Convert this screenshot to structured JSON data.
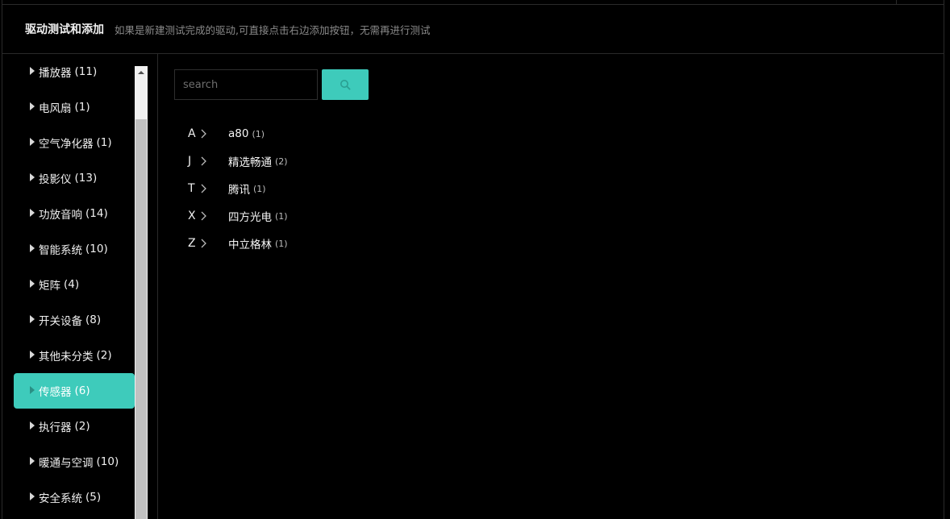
{
  "header": {
    "title": "驱动测试和添加",
    "subtitle": "如果是新建测试完成的驱动,可直接点击右边添加按钮，无需再进行测试"
  },
  "sidebar": {
    "items": [
      {
        "label": "播放器",
        "count": "(11)"
      },
      {
        "label": "电风扇",
        "count": "(1)"
      },
      {
        "label": "空气净化器",
        "count": "(1)"
      },
      {
        "label": "投影仪",
        "count": "(13)"
      },
      {
        "label": "功放音响",
        "count": "(14)"
      },
      {
        "label": "智能系统",
        "count": "(10)"
      },
      {
        "label": "矩阵",
        "count": "(4)"
      },
      {
        "label": "开关设备",
        "count": "(8)"
      },
      {
        "label": "其他未分类",
        "count": "(2)"
      },
      {
        "label": "传感器",
        "count": "(6)",
        "active": true
      },
      {
        "label": "执行器",
        "count": "(2)"
      },
      {
        "label": "暖通与空调",
        "count": "(10)"
      },
      {
        "label": "安全系统",
        "count": "(5)"
      }
    ]
  },
  "search": {
    "placeholder": "search",
    "value": "",
    "button_icon": "search-icon"
  },
  "brands": [
    {
      "letter": "A",
      "name": "a80",
      "count": "(1)"
    },
    {
      "letter": "J",
      "name": "精选畅通",
      "count": "(2)"
    },
    {
      "letter": "T",
      "name": "腾讯",
      "count": "(1)"
    },
    {
      "letter": "X",
      "name": "四方光电",
      "count": "(1)"
    },
    {
      "letter": "Z",
      "name": "中立格林",
      "count": "(1)"
    }
  ],
  "colors": {
    "accent": "#3ecbbb",
    "background": "#000000",
    "border": "#2a2a2a"
  }
}
